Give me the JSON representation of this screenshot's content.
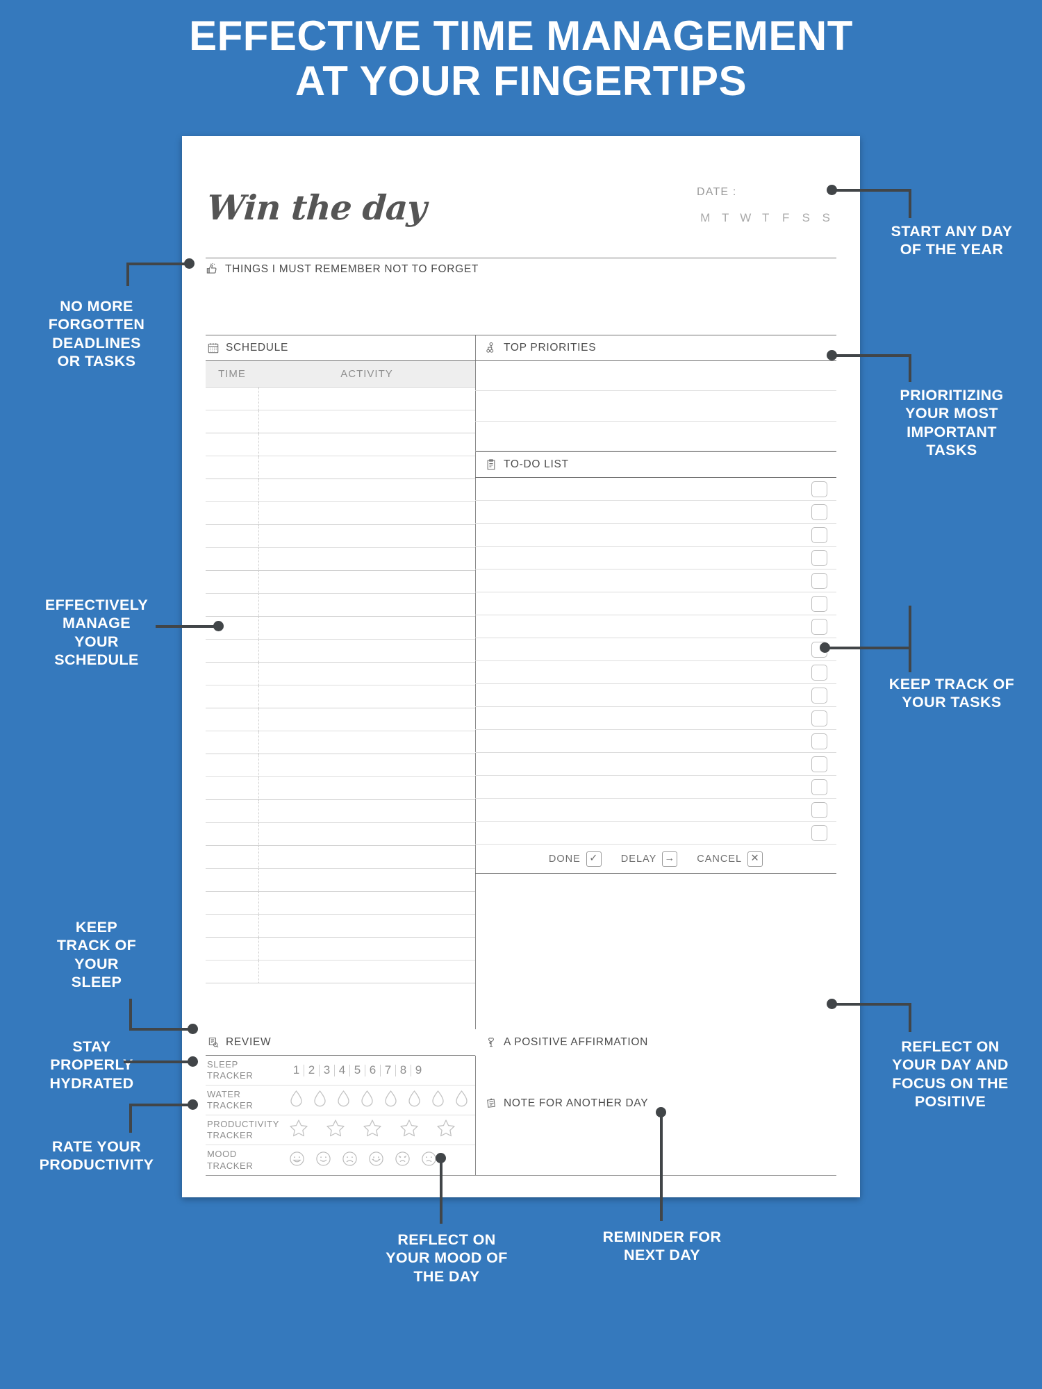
{
  "headline": {
    "line1": "EFFECTIVE TIME MANAGEMENT",
    "line2": "AT YOUR FINGERTIPS"
  },
  "colors": {
    "background_blue": "#3579bd",
    "sheet_white": "#ffffff",
    "callout_line": "#414548",
    "ink_gray": "#555555",
    "muted_gray": "#9a9a9a"
  },
  "planner": {
    "brand_title": "Win the day",
    "date": {
      "label": "DATE :",
      "weekdays": [
        "M",
        "T",
        "W",
        "T",
        "F",
        "S",
        "S"
      ]
    },
    "remember": {
      "icon": "thumbs-up-icon",
      "label": "THINGS I MUST REMEMBER NOT TO FORGET"
    },
    "schedule": {
      "icon": "calendar-icon",
      "label": "SCHEDULE",
      "columns": [
        "TIME",
        "ACTIVITY"
      ],
      "row_count": 26
    },
    "top_priorities": {
      "icon": "priorities-icon",
      "label": "TOP PRIORITIES",
      "row_count": 3
    },
    "todo": {
      "icon": "clipboard-list-icon",
      "label": "TO-DO LIST",
      "row_count": 16,
      "legend": [
        {
          "label": "DONE",
          "glyph": "✓",
          "icon": "check-icon"
        },
        {
          "label": "DELAY",
          "glyph": "→",
          "icon": "arrow-right-icon"
        },
        {
          "label": "CANCEL",
          "glyph": "✕",
          "icon": "cross-icon"
        }
      ]
    },
    "review": {
      "icon": "review-clipboard-icon",
      "label": "REVIEW",
      "trackers": [
        {
          "name_line1": "SLEEP",
          "name_line2": "TRACKER",
          "type": "numbers",
          "values": [
            "1",
            "2",
            "3",
            "4",
            "5",
            "6",
            "7",
            "8",
            "9"
          ]
        },
        {
          "name_line1": "WATER",
          "name_line2": "TRACKER",
          "type": "drops",
          "count": 8
        },
        {
          "name_line1": "PRODUCTIVITY",
          "name_line2": "TRACKER",
          "type": "stars",
          "count": 5
        },
        {
          "name_line1": "MOOD",
          "name_line2": "TRACKER",
          "type": "faces",
          "count": 6
        }
      ]
    },
    "affirmation": {
      "icon": "lightbulb-plant-icon",
      "label": "A POSITIVE AFFIRMATION"
    },
    "note": {
      "icon": "sticky-note-icon",
      "label": "NOTE FOR ANOTHER DAY"
    }
  },
  "callouts": {
    "no_more_forgotten": "NO MORE\nFORGOTTEN\nDEADLINES\nOR TASKS",
    "effectively_manage": "EFFECTIVELY\nMANAGE\nYOUR\nSCHEDULE",
    "keep_track_sleep": "KEEP\nTRACK OF\nYOUR\nSLEEP",
    "stay_hydrated": "STAY\nPROPERLY\nHYDRATED",
    "rate_productivity": "RATE YOUR\nPRODUCTIVITY",
    "start_any_day": "START ANY DAY\nOF THE YEAR",
    "prioritizing": "PRIORITIZING\nYOUR MOST\nIMPORTANT\nTASKS",
    "keep_track_tasks": "KEEP TRACK OF\nYOUR TASKS",
    "reflect_focus": "REFLECT ON\nYOUR DAY AND\nFOCUS ON THE\nPOSITIVE",
    "reflect_mood": "REFLECT ON\nYOUR MOOD OF\nTHE DAY",
    "reminder_next_day": "REMINDER FOR\nNEXT DAY"
  }
}
